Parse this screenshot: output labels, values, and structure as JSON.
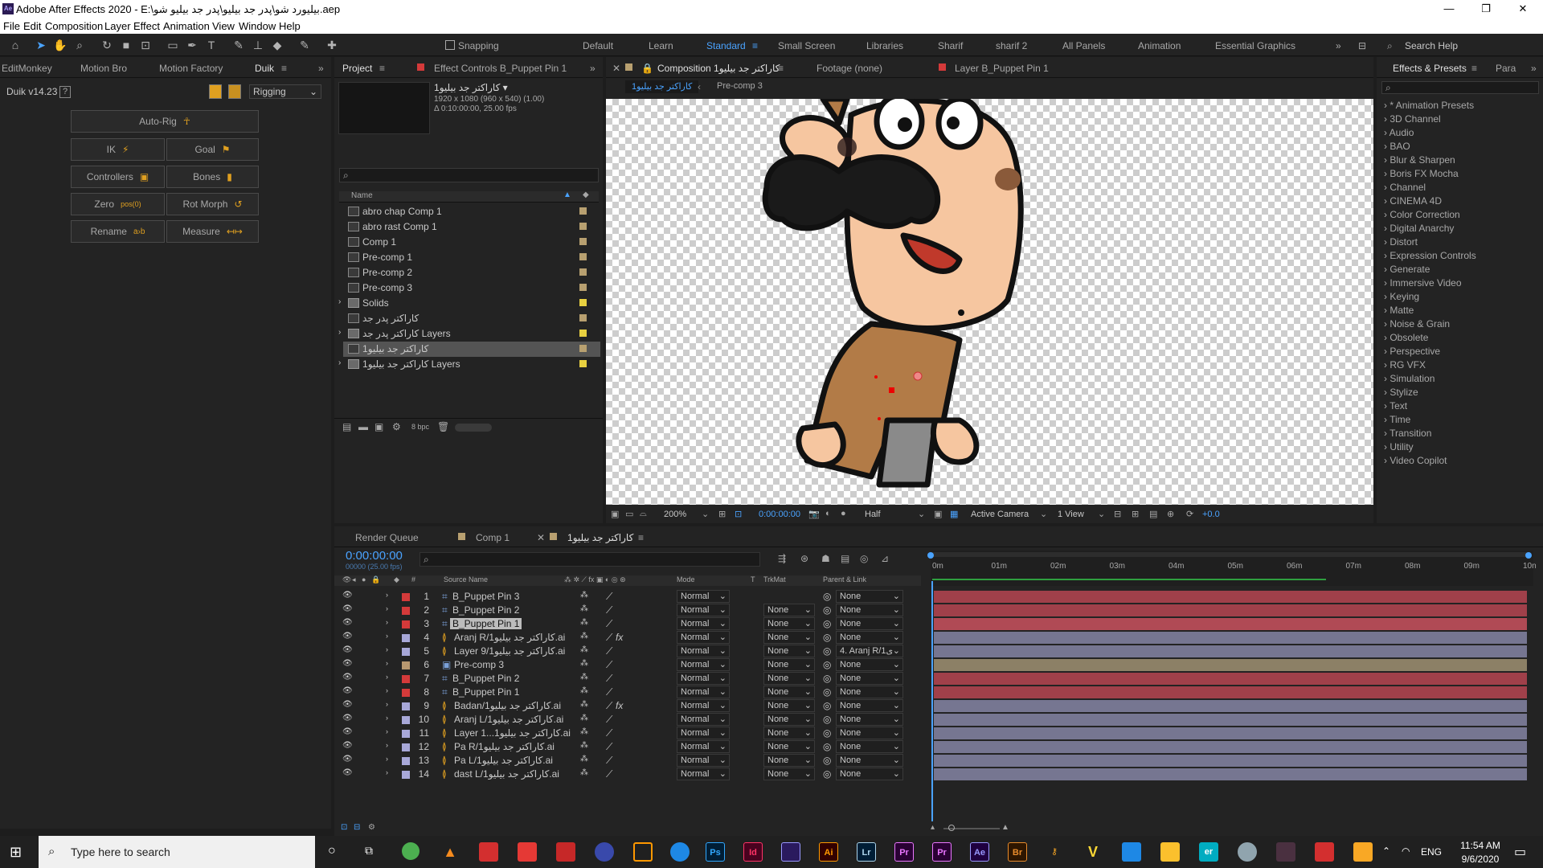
{
  "window": {
    "title": "Adobe After Effects 2020 - E:\\بیلیورد شو\\پدر جد بیلیو\\پدر جد بیلیو شو.aep",
    "app_badge": "Ae",
    "minimize": "—",
    "maximize": "❐",
    "close": "✕"
  },
  "menu": [
    "File",
    "Edit",
    "Composition",
    "Layer",
    "Effect",
    "Animation",
    "View",
    "Window",
    "Help"
  ],
  "toolbar": {
    "snapping": "Snapping",
    "workspaces": [
      "Default",
      "Learn",
      "Standard",
      "Small Screen",
      "Libraries",
      "Sharif",
      "sharif 2",
      "All Panels",
      "Animation",
      "Essential Graphics"
    ],
    "active_workspace": "Standard",
    "search_help": "Search Help"
  },
  "left_tabs": [
    "EditMonkey",
    "Motion Bro",
    "Motion Factory",
    "Duik"
  ],
  "duik": {
    "version": "Duik v14.23",
    "help": "?",
    "mode": "Rigging",
    "buttons": [
      {
        "label": "Auto-Rig",
        "icon": "auto-rig-icon"
      },
      {
        "label": "IK",
        "icon": "ik-icon"
      },
      {
        "label": "Goal",
        "icon": "goal-icon"
      },
      {
        "label": "Controllers",
        "icon": "controllers-icon"
      },
      {
        "label": "Bones",
        "icon": "bones-icon"
      },
      {
        "label": "Zero",
        "icon": "zero-icon",
        "badge": "pos(0)"
      },
      {
        "label": "Rot Morph",
        "icon": "rot-morph-icon"
      },
      {
        "label": "Rename",
        "icon": "rename-icon",
        "badge": "a›b"
      },
      {
        "label": "Measure",
        "icon": "measure-icon",
        "badge": "↤↦"
      }
    ]
  },
  "project": {
    "tab": "Project",
    "effect_controls_tab": "Effect Controls B_Puppet Pin 1",
    "comp_name": "کاراکتر جد بیلیو1 ▾",
    "comp_info_1": "1920 x 1080  (960 x 540) (1.00)",
    "comp_info_2": "Δ 0:10:00:00, 25.00 fps",
    "search_placeholder": "",
    "col_name": "Name",
    "bpc": "8 bpc",
    "items": [
      {
        "name": "abro chap Comp 1",
        "type": "comp",
        "label": "#b8a070"
      },
      {
        "name": "abro rast Comp 1",
        "type": "comp",
        "label": "#b8a070"
      },
      {
        "name": "Comp 1",
        "type": "comp",
        "label": "#b8a070"
      },
      {
        "name": "Pre-comp 1",
        "type": "comp",
        "label": "#b8a070"
      },
      {
        "name": "Pre-comp 2",
        "type": "comp",
        "label": "#b8a070"
      },
      {
        "name": "Pre-comp 3",
        "type": "comp",
        "label": "#b8a070"
      },
      {
        "name": "Solids",
        "type": "folder",
        "label": "#e8d040"
      },
      {
        "name": "کاراکتر پدر جد",
        "type": "comp",
        "label": "#b8a070"
      },
      {
        "name": "کاراکتر پدر جد Layers",
        "type": "folder",
        "label": "#e8d040"
      },
      {
        "name": "کاراکتر جد بیلیو1",
        "type": "comp",
        "label": "#b8a070",
        "selected": true
      },
      {
        "name": "کاراکتر جد بیلیو1 Layers",
        "type": "folder",
        "label": "#e8d040"
      }
    ]
  },
  "viewer": {
    "comp_tab": "Composition کاراکتر جد بیلیو1",
    "footage_tab": "Footage (none)",
    "layer_tab": "Layer B_Puppet Pin 1",
    "crumb_1": "کاراکتر جد بیلیو1",
    "crumb_2": "Pre-comp 3",
    "zoom": "200%",
    "timecode": "0:00:00:00",
    "resolution": "Half",
    "camera": "Active Camera",
    "views": "1 View",
    "exposure": "+0.0"
  },
  "effects": {
    "tab": "Effects & Presets",
    "tab2": "Para",
    "items": [
      "* Animation Presets",
      "3D Channel",
      "Audio",
      "BAO",
      "Blur & Sharpen",
      "Boris FX Mocha",
      "Channel",
      "CINEMA 4D",
      "Color Correction",
      "Digital Anarchy",
      "Distort",
      "Expression Controls",
      "Generate",
      "Immersive Video",
      "Keying",
      "Matte",
      "Noise & Grain",
      "Obsolete",
      "Perspective",
      "RG VFX",
      "Simulation",
      "Stylize",
      "Text",
      "Time",
      "Transition",
      "Utility",
      "Video Copilot"
    ]
  },
  "timeline": {
    "tabs": [
      "Render Queue",
      "Comp 1",
      "کاراکتر جد بیلیو1"
    ],
    "timecode": "0:00:00:00",
    "frames": "00000 (25.00 fps)",
    "col_source": "Source Name",
    "col_mode": "Mode",
    "col_t": "T",
    "col_trkmat": "TrkMat",
    "col_parent": "Parent & Link",
    "ruler": [
      "0m",
      "01m",
      "02m",
      "03m",
      "04m",
      "05m",
      "06m",
      "07m",
      "08m",
      "09m",
      "10n"
    ],
    "layers": [
      {
        "num": "1",
        "name": "B_Puppet Pin 3",
        "label": "#d43a3a",
        "type": "pin",
        "mode": "Normal",
        "trk": "",
        "parent": "None",
        "bar": "#a0404a"
      },
      {
        "num": "2",
        "name": "B_Puppet Pin 2",
        "label": "#d43a3a",
        "type": "pin",
        "mode": "Normal",
        "trk": "None",
        "parent": "None",
        "bar": "#a0404a"
      },
      {
        "num": "3",
        "name": "B_Puppet Pin 1",
        "label": "#d43a3a",
        "type": "pin",
        "mode": "Normal",
        "trk": "None",
        "parent": "None",
        "bar": "#b04a55",
        "selected": true
      },
      {
        "num": "4",
        "name": "Aranj R/1کاراکتر جد بیلیو.ai",
        "label": "#a8a8d8",
        "type": "ai",
        "mode": "Normal",
        "trk": "None",
        "parent": "None",
        "fx": "fx",
        "bar": "#767691"
      },
      {
        "num": "5",
        "name": "Layer 9/1کاراکتر جد بیلیو.ai",
        "label": "#a8a8d8",
        "type": "ai",
        "mode": "Normal",
        "trk": "None",
        "parent": "4. Aranj R/1ی",
        "bar": "#767691"
      },
      {
        "num": "6",
        "name": "Pre-comp 3",
        "label": "#b89870",
        "type": "comp",
        "mode": "Normal",
        "trk": "None",
        "parent": "None",
        "bar": "#8c8066"
      },
      {
        "num": "7",
        "name": "B_Puppet Pin 2",
        "label": "#d43a3a",
        "type": "pin",
        "mode": "Normal",
        "trk": "None",
        "parent": "None",
        "bar": "#a0404a"
      },
      {
        "num": "8",
        "name": "B_Puppet Pin 1",
        "label": "#d43a3a",
        "type": "pin",
        "mode": "Normal",
        "trk": "None",
        "parent": "None",
        "bar": "#a0404a"
      },
      {
        "num": "9",
        "name": "Badan/1کاراکتر جد بیلیو.ai",
        "label": "#a8a8d8",
        "type": "ai",
        "mode": "Normal",
        "trk": "None",
        "parent": "None",
        "fx": "fx",
        "bar": "#767691"
      },
      {
        "num": "10",
        "name": "Aranj L/1کاراکتر جد بیلیو.ai",
        "label": "#a8a8d8",
        "type": "ai",
        "mode": "Normal",
        "trk": "None",
        "parent": "None",
        "bar": "#767691"
      },
      {
        "num": "11",
        "name": "Layer 1...1کاراکتر جد بیلیو.ai",
        "label": "#a8a8d8",
        "type": "ai",
        "mode": "Normal",
        "trk": "None",
        "parent": "None",
        "bar": "#767691"
      },
      {
        "num": "12",
        "name": "Pa R/1کاراکتر جد بیلیو.ai",
        "label": "#a8a8d8",
        "type": "ai",
        "mode": "Normal",
        "trk": "None",
        "parent": "None",
        "bar": "#767691"
      },
      {
        "num": "13",
        "name": "Pa L/1کاراکتر جد بیلیو.ai",
        "label": "#a8a8d8",
        "type": "ai",
        "mode": "Normal",
        "trk": "None",
        "parent": "None",
        "bar": "#767691"
      },
      {
        "num": "14",
        "name": "dast L/1کاراکتر جد بیلیو.ai",
        "label": "#a8a8d8",
        "type": "ai",
        "mode": "Normal",
        "trk": "None",
        "parent": "None",
        "bar": "#767691"
      }
    ]
  },
  "taskbar": {
    "search": "Type here to search",
    "lang": "ENG",
    "time": "11:54 AM",
    "date": "9/6/2020",
    "apps": [
      {
        "t": "Ps",
        "bg": "#001e36",
        "fg": "#31a8ff"
      },
      {
        "t": "Id",
        "bg": "#49021f",
        "fg": "#ff3366"
      },
      {
        "t": "",
        "bg": "#2a1a5e",
        "fg": "#9999ff"
      },
      {
        "t": "Ai",
        "bg": "#330000",
        "fg": "#ff9a00"
      },
      {
        "t": "Lr",
        "bg": "#001e36",
        "fg": "#add5ec"
      },
      {
        "t": "Pr",
        "bg": "#2a0134",
        "fg": "#ea77ff"
      },
      {
        "t": "Pr",
        "bg": "#2a0134",
        "fg": "#ea77ff"
      },
      {
        "t": "Ae",
        "bg": "#1f0040",
        "fg": "#9999ff"
      },
      {
        "t": "Br",
        "bg": "#2e1600",
        "fg": "#e88c2c"
      }
    ]
  }
}
